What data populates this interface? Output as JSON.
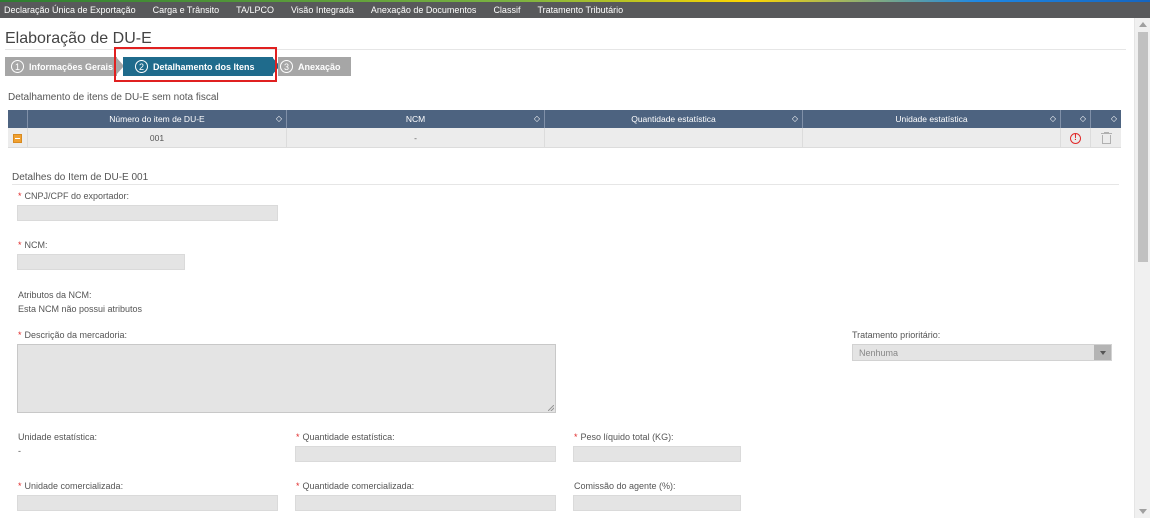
{
  "topnav": {
    "items": [
      "Declaração Única de Exportação",
      "Carga e Trânsito",
      "TA/LPCO",
      "Visão Integrada",
      "Anexação de Documentos",
      "Classif",
      "Tratamento Tributário"
    ]
  },
  "page": {
    "title": "Elaboração de DU-E"
  },
  "wizard": {
    "steps": [
      {
        "num": "1",
        "label": "Informações Gerais"
      },
      {
        "num": "2",
        "label": "Detalhamento dos Itens"
      },
      {
        "num": "3",
        "label": "Anexação"
      }
    ],
    "active_step": 2
  },
  "items_section": {
    "title": "Detalhamento de itens de DU-E sem nota fiscal",
    "columns": [
      "Número do item de DU-E",
      "NCM",
      "Quantidade estatística",
      "Unidade estatística"
    ],
    "rows": [
      {
        "numero": "001",
        "ncm": "-",
        "quantidade": "",
        "unidade": ""
      }
    ],
    "sort_glyph": "◇"
  },
  "details": {
    "title": "Detalhes do Item de DU-E 001",
    "required_mark": "*",
    "cnpj_label": "CNPJ/CPF do exportador:",
    "ncm_label": "NCM:",
    "atributos_label": "Atributos da NCM:",
    "atributos_value": "Esta NCM não possui atributos",
    "descricao_label": "Descrição da mercadoria:",
    "tratamento_label": "Tratamento prioritário:",
    "tratamento_value": "Nenhuma",
    "unidade_estatistica_label": "Unidade estatística:",
    "unidade_estatistica_value": "-",
    "quantidade_estatistica_label": "Quantidade estatística:",
    "peso_label": "Peso líquido total (KG):",
    "unidade_comercializada_label": "Unidade comercializada:",
    "quantidade_comercializada_label": "Quantidade comercializada:",
    "comissao_label": "Comissão do agente (%):"
  },
  "colors": {
    "topbar": "#58595b",
    "step_active": "#1f6b8c",
    "step_inactive": "#a6a6a6",
    "grid_header": "#4d6380",
    "highlight": "#e02020",
    "required": "#e02a2a"
  }
}
